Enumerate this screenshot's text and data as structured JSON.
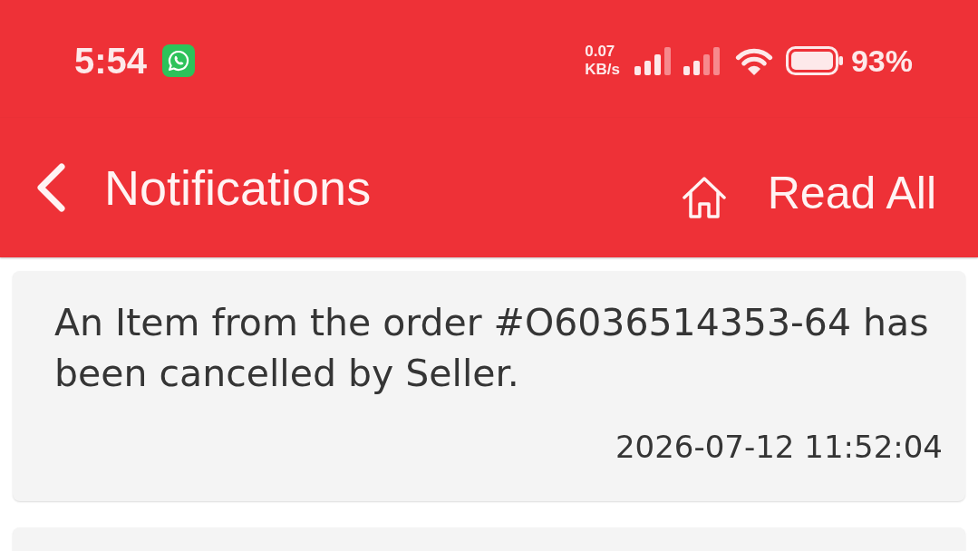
{
  "status_bar": {
    "time": "5:54",
    "network_speed": "0.07",
    "network_speed_unit": "KB/s",
    "battery": "93%"
  },
  "header": {
    "title": "Notifications",
    "action": "Read All"
  },
  "notifications": [
    {
      "kind": "message",
      "message": "An Item from the order #O6036514353-64 has been cancelled by Seller.",
      "timestamp": "2026-07-12 11:52:04"
    },
    {
      "kind": "clipped"
    }
  ]
}
